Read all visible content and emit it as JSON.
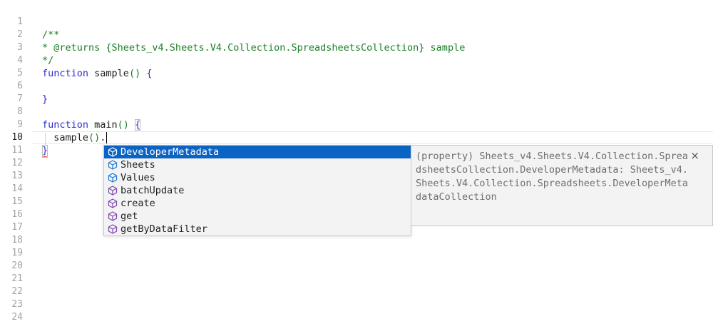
{
  "gutter": {
    "line_numbers": [
      "1",
      "2",
      "3",
      "4",
      "5",
      "6",
      "7",
      "8",
      "9",
      "10",
      "11",
      "12",
      "13",
      "14",
      "15",
      "16",
      "17",
      "18",
      "19",
      "20",
      "21",
      "22",
      "23",
      "24"
    ],
    "active_line": "10"
  },
  "code": {
    "l2_comment": "/**",
    "l3_comment": "* @returns {Sheets_v4.Sheets.V4.Collection.SpreadsheetsCollection} sample",
    "l4_comment": "*/",
    "l5_kw": "function",
    "l5_name": " sample",
    "l5_paren": "()",
    "l5_brace": " {",
    "l7_brace": "}",
    "l9_kw": "function",
    "l9_name": " main",
    "l9_paren": "()",
    "l9_brace": "{",
    "l10_text": "  sample",
    "l10_paren": "()",
    "l10_dot": ".",
    "l11_brace": "}"
  },
  "suggest": {
    "items": [
      {
        "label": "DeveloperMetadata",
        "kind": "property"
      },
      {
        "label": "Sheets",
        "kind": "property"
      },
      {
        "label": "Values",
        "kind": "property"
      },
      {
        "label": "batchUpdate",
        "kind": "method"
      },
      {
        "label": "create",
        "kind": "method"
      },
      {
        "label": "get",
        "kind": "method"
      },
      {
        "label": "getByDataFilter",
        "kind": "method"
      }
    ],
    "selected_index": 0
  },
  "details": {
    "text": "(property) Sheets_v4.Sheets.V4.Collection.SpreadsheetsCollection.DeveloperMetadata: Sheets_v4.Sheets.V4.Collection.Spreadsheets.DeveloperMetadataCollection",
    "close_label": "×"
  },
  "colors": {
    "selection": "#0b63c4",
    "property_icon": "#1f7ad6",
    "method_icon": "#7d48b0",
    "comment": "#1a8025",
    "keyword": "#2f2fd0"
  }
}
